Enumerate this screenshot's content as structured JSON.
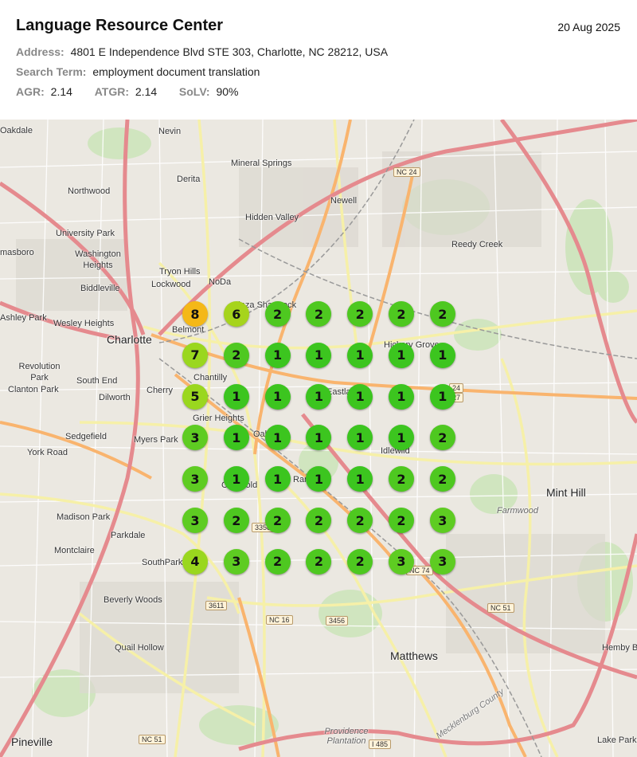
{
  "header": {
    "title": "Language Resource Center",
    "date": "20 Aug 2025",
    "address_label": "Address:",
    "address": "4801 E Independence Blvd STE 303, Charlotte, NC 28212, USA",
    "search_label": "Search Term:",
    "search_term": "employment document translation",
    "agr_label": "AGR:",
    "agr": "2.14",
    "atgr_label": "ATGR:",
    "atgr": "2.14",
    "solv_label": "SoLV:",
    "solv": "90%"
  },
  "grid": {
    "rows": [
      [
        8,
        6,
        2,
        2,
        2,
        2,
        2
      ],
      [
        7,
        2,
        1,
        1,
        1,
        1,
        1
      ],
      [
        5,
        1,
        1,
        1,
        1,
        1,
        1
      ],
      [
        3,
        1,
        1,
        1,
        1,
        1,
        2
      ],
      [
        3,
        1,
        1,
        1,
        1,
        2,
        2
      ],
      [
        3,
        2,
        2,
        2,
        2,
        2,
        3
      ],
      [
        4,
        3,
        2,
        2,
        2,
        3,
        3
      ]
    ],
    "colors": {
      "1": "#3cc51f",
      "2": "#4ec820",
      "3": "#5ecc22",
      "4": "#9ad71e",
      "5": "#9ad71e",
      "6": "#a6d41c",
      "7": "#9ad71e",
      "8": "#f4b817"
    }
  },
  "places": [
    {
      "name": "Oakdale",
      "big": false
    },
    {
      "name": "Nevin",
      "big": false
    },
    {
      "name": "Mineral Springs",
      "big": false
    },
    {
      "name": "Derita",
      "big": false
    },
    {
      "name": "Northwood",
      "big": false
    },
    {
      "name": "Newell",
      "big": false
    },
    {
      "name": "Hidden Valley",
      "big": false
    },
    {
      "name": "University Park",
      "big": false
    },
    {
      "name": "Washington Heights",
      "big": false
    },
    {
      "name": "masboro",
      "big": false
    },
    {
      "name": "Reedy Creek",
      "big": false
    },
    {
      "name": "Tryon Hills",
      "big": false
    },
    {
      "name": "NoDa",
      "big": false
    },
    {
      "name": "Lockwood",
      "big": false
    },
    {
      "name": "Biddleville",
      "big": false
    },
    {
      "name": "Ashley Park",
      "big": false
    },
    {
      "name": "Wesley Heights",
      "big": false
    },
    {
      "name": "Belmont",
      "big": false
    },
    {
      "name": "Charlotte",
      "big": true
    },
    {
      "name": "Plaza Shamrock",
      "big": false
    },
    {
      "name": "Hickory Grove",
      "big": false
    },
    {
      "name": "Revolution Park",
      "big": false
    },
    {
      "name": "Clanton Park",
      "big": false
    },
    {
      "name": "South End",
      "big": false
    },
    {
      "name": "Chantilly",
      "big": false
    },
    {
      "name": "Dilworth",
      "big": false
    },
    {
      "name": "Cherry",
      "big": false
    },
    {
      "name": "Eastland",
      "big": false
    },
    {
      "name": "Grier Heights",
      "big": false
    },
    {
      "name": "Sedgefield",
      "big": false
    },
    {
      "name": "Myers Park",
      "big": false
    },
    {
      "name": "Oakhurst",
      "big": false
    },
    {
      "name": "York Road",
      "big": false
    },
    {
      "name": "Idlewild",
      "big": false
    },
    {
      "name": "Mint Hill",
      "big": true
    },
    {
      "name": "Cotswold",
      "big": false
    },
    {
      "name": "Randolph",
      "big": false
    },
    {
      "name": "Farmwood",
      "big": false
    },
    {
      "name": "Madison Park",
      "big": false
    },
    {
      "name": "Parkdale",
      "big": false
    },
    {
      "name": "Montclaire",
      "big": false
    },
    {
      "name": "SouthPark",
      "big": false
    },
    {
      "name": "Beverly Woods",
      "big": false
    },
    {
      "name": "Quail Hollow",
      "big": false
    },
    {
      "name": "Matthews",
      "big": true
    },
    {
      "name": "Hemby Br",
      "big": false
    },
    {
      "name": "Providence Plantation",
      "big": false
    },
    {
      "name": "Pineville",
      "big": true
    },
    {
      "name": "Lake Park",
      "big": false
    },
    {
      "name": "Mecklenburg County",
      "big": false
    }
  ],
  "shields": [
    "NC 24",
    "NC 16",
    "NC 51",
    "NC 51",
    "NC 74",
    "3611",
    "3456",
    "3358",
    "I 485",
    "24",
    "27"
  ]
}
